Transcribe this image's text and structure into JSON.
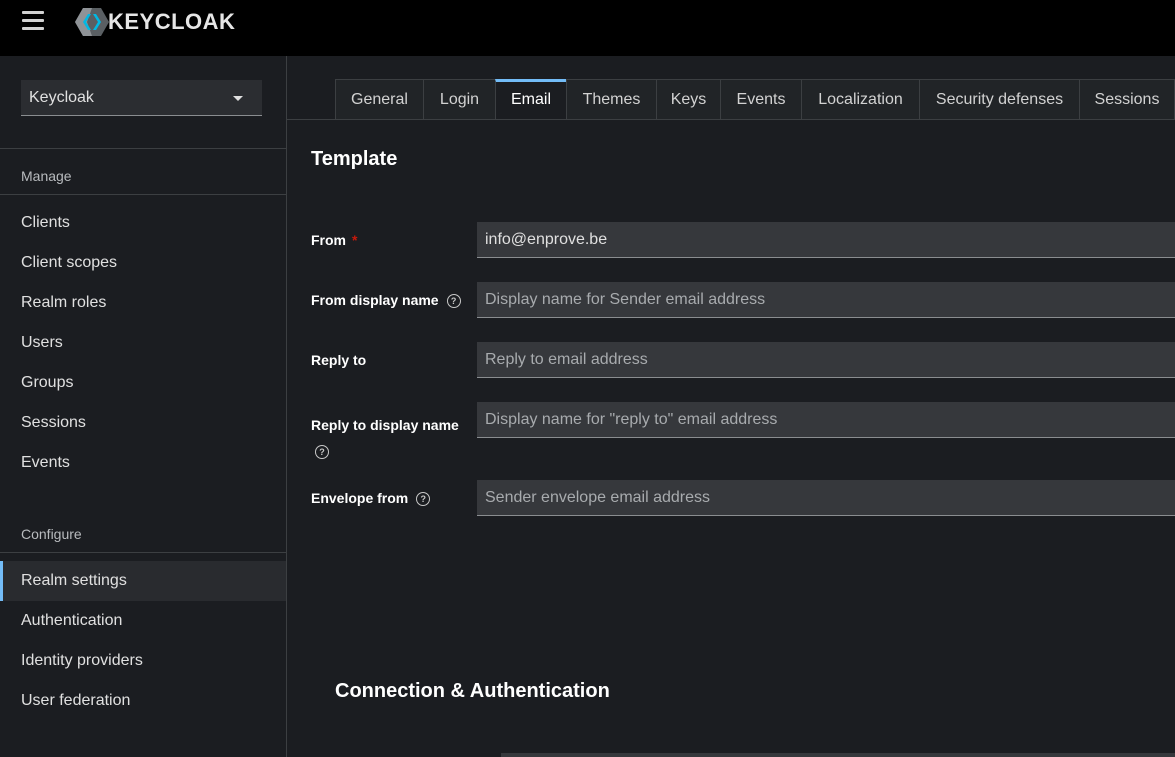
{
  "header": {
    "brand": "KEYCLOAK"
  },
  "sidebar": {
    "realm": "Keycloak",
    "manage_title": "Manage",
    "manage_items": [
      "Clients",
      "Client scopes",
      "Realm roles",
      "Users",
      "Groups",
      "Sessions",
      "Events"
    ],
    "configure_title": "Configure",
    "configure_items": [
      "Realm settings",
      "Authentication",
      "Identity providers",
      "User federation"
    ],
    "active_item": "Realm settings"
  },
  "tabs": [
    "General",
    "Login",
    "Email",
    "Themes",
    "Keys",
    "Events",
    "Localization",
    "Security defenses",
    "Sessions"
  ],
  "active_tab": "Email",
  "template": {
    "title": "Template",
    "from": {
      "label": "From",
      "required": "*",
      "value": "info@enprove.be"
    },
    "from_display_name": {
      "label": "From display name",
      "placeholder": "Display name for Sender email address"
    },
    "reply_to": {
      "label": "Reply to",
      "placeholder": "Reply to email address"
    },
    "reply_to_display_name": {
      "label": "Reply to display name",
      "placeholder": "Display name for \"reply to\" email address"
    },
    "envelope_from": {
      "label": "Envelope from",
      "placeholder": "Sender envelope email address"
    }
  },
  "connection": {
    "title": "Connection & Authentication"
  },
  "colors": {
    "accent": "#73bcf7",
    "masthead": "#000000",
    "background": "#1b1d21",
    "required": "#c9190b"
  }
}
